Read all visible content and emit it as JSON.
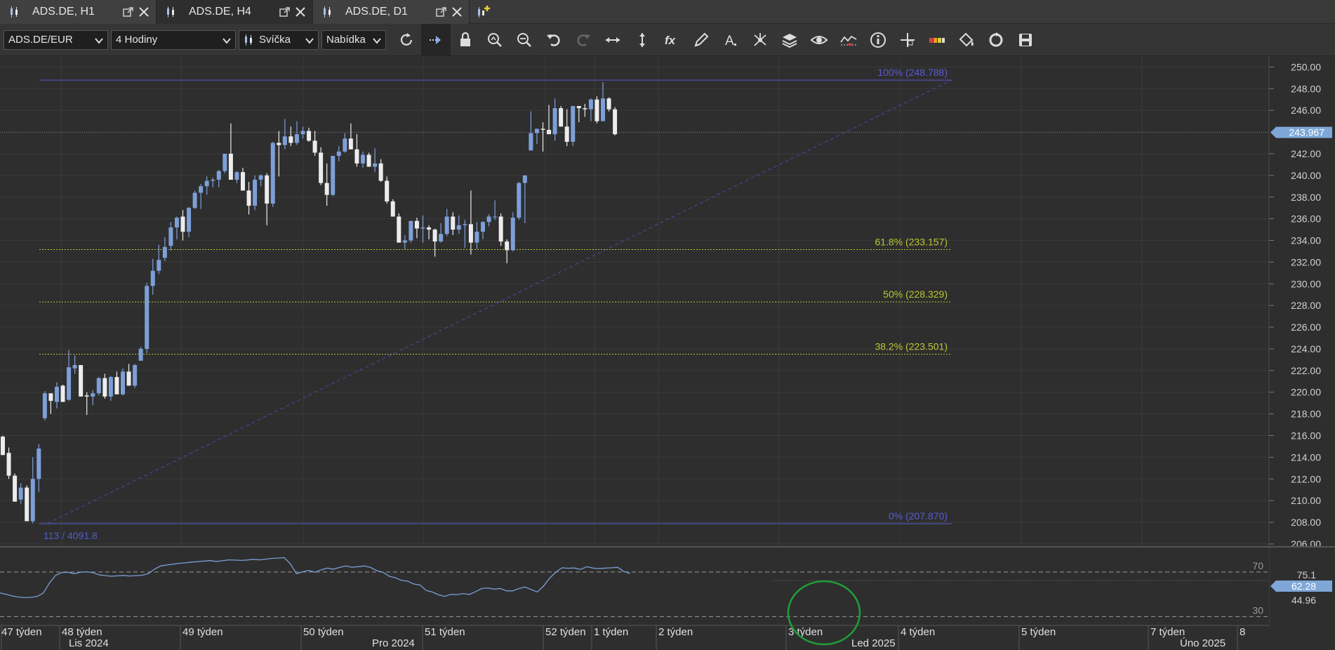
{
  "tabs": [
    {
      "label": "ADS.DE, H1",
      "active": false
    },
    {
      "label": "ADS.DE, H4",
      "active": true
    },
    {
      "label": "ADS.DE, D1",
      "active": false
    }
  ],
  "toolbar": {
    "symbol": "ADS.DE/EUR",
    "timeframe": "4 Hodiny",
    "chart_type": "Svíčka",
    "price_side": "Nabídka",
    "tools": [
      "refresh-icon",
      "autoscroll-icon",
      "lock-icon",
      "zoom-in-icon",
      "zoom-out-icon",
      "undo-icon",
      "redo-icon",
      "horizontal-expand-icon",
      "vertical-expand-icon",
      "indicator-fx-icon",
      "pencil-icon",
      "text-tool-icon",
      "network-icon",
      "layers-icon",
      "eye-icon",
      "stats-icon",
      "info-icon",
      "crosshair-icon",
      "palette-icon",
      "paint-bucket-icon",
      "sync-icon",
      "save-icon"
    ]
  },
  "chart_data": {
    "type": "candlestick",
    "y_axis_labels": [
      "250.00",
      "248.00",
      "246.00",
      "243.967",
      "242.00",
      "240.00",
      "238.00",
      "236.00",
      "234.00",
      "232.00",
      "230.00",
      "228.00",
      "226.00",
      "224.00",
      "222.00",
      "220.00",
      "218.00",
      "216.00",
      "214.00",
      "212.00",
      "210.00",
      "208.00",
      "206.00"
    ],
    "ylim": [
      205.8,
      251
    ],
    "current_price": "243.967",
    "fibonacci": [
      {
        "level": "100% (248.788)",
        "value": 248.788,
        "color": "#5b5bd6"
      },
      {
        "level": "61.8% (233.157)",
        "value": 233.157,
        "color": "#b8c832"
      },
      {
        "level": "50% (228.329)",
        "value": 228.329,
        "color": "#b8c832"
      },
      {
        "level": "38.2% (223.501)",
        "value": 223.501,
        "color": "#b8c832"
      },
      {
        "level": "0% (207.870)",
        "value": 207.87,
        "color": "#5b5bd6"
      }
    ],
    "fib_anchor_label": "113 / 4091.8",
    "candles": [
      [
        215.9,
        216.0,
        214.4,
        214.2
      ],
      [
        214.4,
        214.9,
        212.0,
        212.3
      ],
      [
        212.3,
        212.5,
        210.1,
        209.9
      ],
      [
        210.1,
        211.6,
        209.7,
        211.2
      ],
      [
        211.2,
        211.4,
        208.1,
        208.1
      ],
      [
        208.1,
        214.0,
        207.9,
        212.0
      ],
      [
        212.0,
        215.2,
        210.8,
        214.8
      ],
      [
        217.6,
        220.1,
        217.4,
        219.9
      ],
      [
        219.9,
        219.8,
        218.0,
        219.2
      ],
      [
        219.1,
        220.9,
        218.5,
        220.5
      ],
      [
        220.6,
        220.7,
        219.3,
        219.1
      ],
      [
        219.3,
        223.9,
        219.2,
        222.3
      ],
      [
        222.2,
        223.4,
        221.7,
        222.5
      ],
      [
        222.5,
        222.5,
        219.7,
        219.6
      ],
      [
        219.7,
        220.0,
        217.9,
        219.6
      ],
      [
        219.6,
        220.2,
        218.8,
        219.9
      ],
      [
        219.9,
        221.4,
        219.7,
        221.3
      ],
      [
        221.3,
        221.7,
        219.4,
        219.6
      ],
      [
        219.6,
        221.5,
        219.2,
        221.4
      ],
      [
        221.4,
        221.9,
        220.1,
        219.8
      ],
      [
        219.8,
        222.2,
        219.7,
        221.9
      ],
      [
        221.9,
        222.6,
        220.9,
        220.6
      ],
      [
        220.6,
        222.6,
        220.4,
        222.5
      ],
      [
        222.9,
        224.2,
        223.2,
        224.0
      ],
      [
        224.0,
        230.1,
        223.6,
        229.8
      ],
      [
        229.8,
        232.3,
        229.0,
        231.2
      ],
      [
        231.2,
        233.6,
        230.9,
        232.2
      ],
      [
        232.4,
        234.3,
        232.1,
        233.4
      ],
      [
        233.5,
        235.7,
        233.1,
        235.2
      ],
      [
        235.2,
        236.2,
        234.1,
        236.1
      ],
      [
        236.2,
        236.8,
        234.0,
        234.8
      ],
      [
        234.8,
        237.1,
        234.3,
        237.0
      ],
      [
        237.0,
        238.6,
        236.9,
        238.4
      ],
      [
        238.4,
        239.2,
        236.9,
        239.0
      ],
      [
        239.0,
        239.9,
        238.2,
        239.5
      ],
      [
        239.5,
        239.8,
        238.9,
        239.6
      ],
      [
        239.6,
        240.5,
        238.9,
        240.4
      ],
      [
        240.4,
        242.0,
        240.2,
        242.0
      ],
      [
        242.0,
        244.8,
        239.6,
        239.6
      ],
      [
        239.6,
        240.4,
        239.3,
        240.3
      ],
      [
        240.3,
        240.7,
        238.7,
        238.6
      ],
      [
        238.6,
        239.4,
        236.4,
        237.2
      ],
      [
        237.2,
        240.0,
        236.8,
        239.6
      ],
      [
        239.6,
        240.1,
        239.0,
        240.0
      ],
      [
        240.0,
        240.2,
        235.4,
        237.4
      ],
      [
        237.4,
        243.1,
        237.1,
        243.0
      ],
      [
        243.0,
        244.1,
        239.9,
        242.8
      ],
      [
        242.8,
        245.2,
        242.4,
        243.6
      ],
      [
        243.6,
        244.5,
        242.7,
        243.0
      ],
      [
        243.0,
        245.0,
        242.8,
        243.8
      ],
      [
        243.8,
        244.5,
        243.4,
        244.1
      ],
      [
        244.1,
        244.4,
        243.1,
        243.2
      ],
      [
        243.2,
        244.1,
        241.8,
        242.1
      ],
      [
        242.1,
        242.6,
        239.1,
        239.3
      ],
      [
        239.3,
        241.1,
        237.2,
        238.2
      ],
      [
        238.2,
        241.8,
        238.1,
        241.8
      ],
      [
        241.8,
        242.7,
        241.3,
        242.2
      ],
      [
        242.2,
        243.9,
        242.1,
        243.4
      ],
      [
        243.4,
        244.8,
        242.4,
        242.4
      ],
      [
        242.4,
        243.8,
        240.8,
        241.1
      ],
      [
        241.1,
        242.2,
        240.7,
        241.9
      ],
      [
        241.9,
        242.1,
        240.8,
        240.8
      ],
      [
        240.8,
        242.5,
        240.3,
        241.1
      ],
      [
        241.1,
        241.5,
        239.4,
        239.5
      ],
      [
        239.5,
        239.9,
        237.4,
        237.6
      ],
      [
        237.6,
        237.8,
        236.3,
        236.2
      ],
      [
        236.2,
        236.5,
        233.8,
        233.8
      ],
      [
        233.8,
        234.5,
        233.2,
        234.0
      ],
      [
        234.0,
        235.8,
        233.8,
        235.8
      ],
      [
        235.8,
        236.1,
        234.2,
        235.1
      ],
      [
        235.1,
        236.3,
        233.8,
        235.2
      ],
      [
        235.2,
        235.4,
        234.1,
        235.0
      ],
      [
        235.0,
        235.1,
        232.5,
        233.9
      ],
      [
        233.9,
        235.6,
        233.8,
        234.6
      ],
      [
        234.6,
        236.9,
        234.4,
        236.2
      ],
      [
        236.2,
        236.6,
        234.5,
        235.0
      ],
      [
        235.0,
        236.3,
        234.6,
        235.4
      ],
      [
        235.4,
        235.9,
        233.3,
        235.5
      ],
      [
        235.5,
        238.6,
        232.7,
        233.8
      ],
      [
        233.8,
        235.7,
        233.2,
        234.8
      ],
      [
        234.8,
        235.8,
        234.1,
        235.7
      ],
      [
        235.7,
        236.4,
        235.3,
        236.2
      ],
      [
        236.2,
        237.7,
        235.9,
        236.2
      ],
      [
        236.2,
        236.5,
        233.5,
        233.9
      ],
      [
        233.9,
        234.1,
        231.9,
        233.1
      ],
      [
        233.1,
        236.6,
        233.0,
        236.1
      ],
      [
        236.1,
        239.4,
        235.9,
        239.3
      ],
      [
        239.3,
        240.0,
        235.6,
        240.0
      ],
      [
        242.3,
        245.9,
        242.3,
        243.9
      ],
      [
        243.9,
        244.3,
        242.9,
        244.3
      ],
      [
        244.3,
        244.9,
        242.2,
        244.2
      ],
      [
        244.2,
        246.5,
        244.0,
        243.8
      ],
      [
        243.8,
        247.1,
        243.2,
        246.2
      ],
      [
        246.2,
        246.4,
        244.6,
        244.5
      ],
      [
        244.5,
        246.1,
        242.7,
        243.1
      ],
      [
        243.1,
        244.3,
        242.7,
        246.4
      ],
      [
        246.4,
        246.4,
        244.9,
        246.2
      ],
      [
        246.2,
        246.6,
        245.4,
        246.1
      ],
      [
        246.1,
        247.1,
        245.0,
        247.0
      ],
      [
        247.0,
        247.3,
        244.8,
        245.0
      ],
      [
        245.0,
        248.6,
        245.8,
        247.1
      ],
      [
        247.1,
        247.2,
        245.9,
        246.1
      ],
      [
        246.1,
        246.3,
        243.7,
        243.8
      ]
    ],
    "x_axis_week_labels": [
      "47 týden",
      "48 týden",
      "49 týden",
      "50 týden",
      "51 týden",
      "52 týden",
      "1 týden",
      "2 týden",
      "3 týden",
      "4 týden",
      "5 týden",
      "7 týden",
      "8"
    ],
    "x_axis_month_labels": [
      "Lis 2024",
      "Pro 2024",
      "Led 2025",
      "Úno 2025"
    ]
  },
  "oscillator": {
    "level_labels": [
      "70",
      "30"
    ],
    "axis_labels": [
      "75.1",
      "44.96"
    ],
    "current_value": "62.28",
    "values": [
      51.2,
      50.0,
      48.5,
      47.5,
      47.0,
      47.2,
      48.0,
      51.0,
      60.0,
      67.0,
      69.5,
      69.8,
      68.5,
      69.8,
      70.2,
      69.5,
      67.5,
      66.8,
      66.2,
      66.5,
      66.9,
      66.4,
      66.8,
      67.0,
      68.5,
      72.5,
      75.4,
      76.3,
      77.0,
      77.8,
      78.2,
      78.9,
      79.3,
      79.8,
      80.2,
      79.5,
      80.1,
      80.9,
      80.7,
      80.4,
      80.8,
      81.4,
      80.9,
      81.5,
      82.2,
      82.5,
      82.9,
      77.5,
      68.5,
      70.2,
      71.5,
      69.8,
      72.0,
      73.5,
      72.5,
      74.2,
      75.4,
      74.3,
      74.8,
      75.4,
      74.1,
      71.2,
      69.8,
      66.2,
      64.9,
      62.4,
      61.8,
      59.2,
      58.3,
      53.4,
      52.0,
      49.5,
      48.1,
      49.9,
      49.7,
      50.6,
      49.8,
      52.4,
      55.2,
      55.7,
      54.6,
      55.2,
      53.1,
      53.0,
      55.1,
      56.5,
      54.2,
      52.1,
      57.4,
      64.5,
      69.9,
      73.8,
      73.4,
      73.6,
      72.3,
      74.8,
      73.5,
      73.1,
      73.5,
      73.8,
      74.2,
      70.5,
      68.7
    ]
  },
  "annotation_circle_color": "#1f9e3a"
}
